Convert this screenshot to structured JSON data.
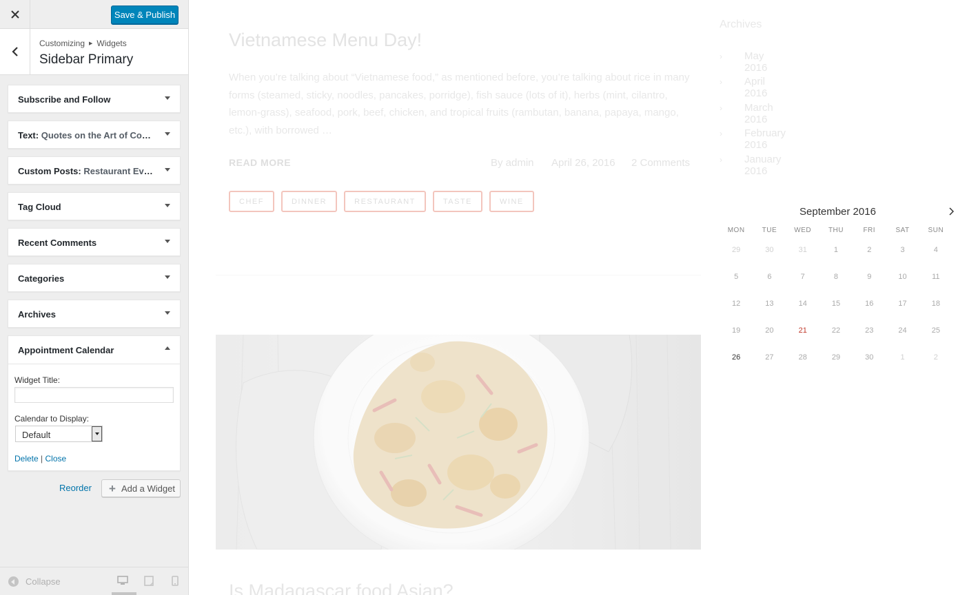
{
  "customizer": {
    "save_label": "Save & Publish",
    "breadcrumb": [
      "Customizing",
      "Widgets"
    ],
    "section_title": "Sidebar Primary",
    "widgets": [
      {
        "title": "Subscribe and Follow",
        "sub": ""
      },
      {
        "title": "Text:",
        "sub": "Quotes on the Art of Cook..."
      },
      {
        "title": "Custom Posts:",
        "sub": "Restaurant Events"
      },
      {
        "title": "Tag Cloud",
        "sub": ""
      },
      {
        "title": "Recent Comments",
        "sub": ""
      },
      {
        "title": "Categories",
        "sub": ""
      },
      {
        "title": "Archives",
        "sub": ""
      }
    ],
    "open_widget": {
      "title": "Appointment Calendar",
      "widget_title_label": "Widget Title:",
      "widget_title_value": "",
      "calendar_label": "Calendar to Display:",
      "calendar_value": "Default",
      "delete_label": "Delete",
      "separator": "|",
      "close_label": "Close"
    },
    "reorder_label": "Reorder",
    "add_widget_label": "Add a Widget",
    "collapse_label": "Collapse"
  },
  "post": {
    "title": "Vietnamese Menu Day!",
    "excerpt": "When you’re talking about “Vietnamese food,” as mentioned before, you’re talking about rice in many forms (steamed, sticky, noodles, pancakes, porridge), fish sauce (lots of it), herbs (mint, cilantro, lemon-grass), seafood, pork, beef, chicken, and tropical fruits (rambutan, banana, papaya, mango, etc.), with borrowed …",
    "read_more": "READ MORE",
    "author": "By admin",
    "date": "April 26, 2016",
    "comments": "2 Comments",
    "tags": [
      "CHEF",
      "DINNER",
      "RESTAURANT",
      "TASTE",
      "WINE"
    ],
    "next_title": "Is Madagascar food Asian?"
  },
  "archives": {
    "title": "Archives",
    "items": [
      "May 2016",
      "April 2016",
      "March 2016",
      "February 2016",
      "January 2016"
    ]
  },
  "calendar": {
    "title": "September 2016",
    "weekdays": [
      "MON",
      "TUE",
      "WED",
      "THU",
      "FRI",
      "SAT",
      "SUN"
    ],
    "weeks": [
      [
        "29",
        "30",
        "31",
        "1",
        "2",
        "3",
        "4"
      ],
      [
        "5",
        "6",
        "7",
        "8",
        "9",
        "10",
        "11"
      ],
      [
        "12",
        "13",
        "14",
        "15",
        "16",
        "17",
        "18"
      ],
      [
        "19",
        "20",
        "21",
        "22",
        "23",
        "24",
        "25"
      ],
      [
        "26",
        "27",
        "28",
        "29",
        "30",
        "1",
        "2"
      ]
    ],
    "today": "21",
    "accent_color": "#c0392b"
  },
  "colors": {
    "primary_button": "#0085ba",
    "link": "#0073aa",
    "tag_border": "#f3c5bd"
  }
}
